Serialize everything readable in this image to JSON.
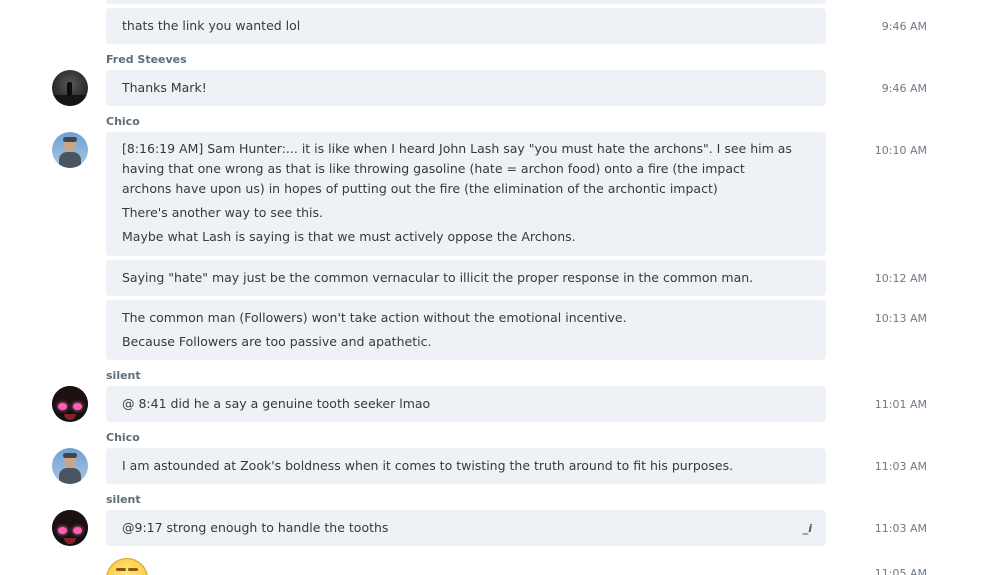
{
  "messages": [
    {
      "text": [
        "thats the link you wanted lol"
      ],
      "time": "9:46 AM"
    },
    {
      "sender": "Fred Steeves",
      "text": [
        "Thanks Mark!"
      ],
      "time": "9:46 AM"
    },
    {
      "sender": "Chico",
      "text": [
        "[8:16:19 AM] Sam Hunter:... it is like when I heard John Lash say \"you must hate the archons\".  I see him as having that one wrong as that is like throwing gasoline (hate = archon food) onto a fire (the impact archons have upon us) in hopes of putting out the fire (the elimination of the archontic impact)",
        "There's another way to see this.",
        "Maybe what Lash is saying is that we must actively oppose the Archons."
      ],
      "time": "10:10 AM"
    },
    {
      "text": [
        "Saying \"hate\" may just be the common vernacular to illicit the proper response in the common man."
      ],
      "time": "10:12 AM"
    },
    {
      "text": [
        "The common man (Followers) won't take action without the emotional incentive.",
        "Because Followers are too passive and apathetic."
      ],
      "time": "10:13 AM"
    },
    {
      "sender": "silent",
      "text": [
        "@ 8:41 did he a say a genuine tooth seeker lmao"
      ],
      "time": "11:01 AM"
    },
    {
      "sender": "Chico",
      "text": [
        "I am astounded at Zook's boldness when it comes to twisting the truth around to fit his purposes."
      ],
      "time": "11:03 AM"
    },
    {
      "sender": "silent",
      "text": [
        "@9:17 strong enough to handle the tooths"
      ],
      "time": "11:03 AM",
      "edit_icon": "_i"
    },
    {
      "time": "11:05 AM"
    }
  ]
}
